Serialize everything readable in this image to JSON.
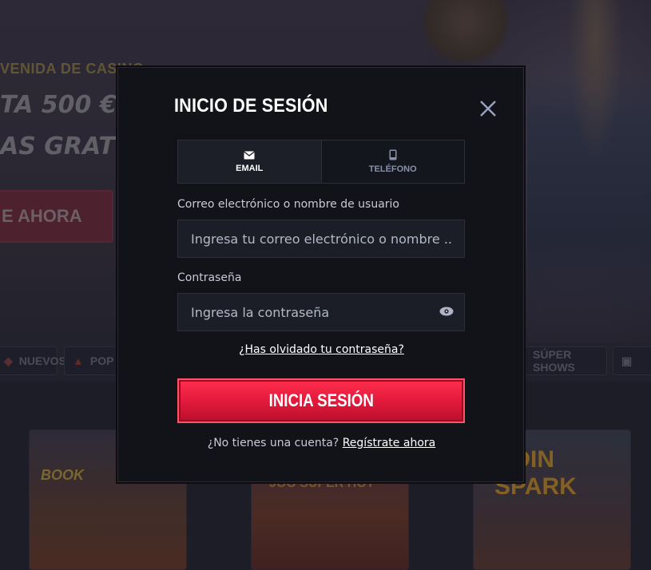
{
  "background": {
    "hero_subtitle": "VENIDA DE CASINO",
    "hero_line1": "TA 500 €",
    "hero_line2": "AS GRAT",
    "hero_cta": "E AHORA",
    "categories": [
      {
        "label": "NUEVOS",
        "icon": "new-icon"
      },
      {
        "label": "POP",
        "icon": "fire-icon"
      },
      {
        "label": "SÚPER SHOWS",
        "icon": ""
      },
      {
        "label": "",
        "icon": "cards-icon"
      }
    ],
    "tiles": [
      {
        "text": "BOOK"
      },
      {
        "text": "JOO SUPER HOT"
      },
      {
        "text": "COIN SPARK"
      }
    ]
  },
  "modal": {
    "title": "INICIO DE SESIÓN",
    "close_icon": "close-icon",
    "tabs": [
      {
        "label": "EMAIL",
        "icon": "envelope-icon",
        "active": true
      },
      {
        "label": "TELÉFONO",
        "icon": "phone-icon",
        "active": false
      }
    ],
    "email": {
      "label": "Correo electrónico o nombre de usuario",
      "placeholder": "Ingresa tu correo electrónico o nombre ..."
    },
    "password": {
      "label": "Contraseña",
      "placeholder": "Ingresa la contraseña",
      "toggle_icon": "eye-icon"
    },
    "forgot_password": "¿Has olvidado tu contraseña?",
    "submit_label": "INICIA SESIÓN",
    "no_account_text": "¿No tienes una cuenta?",
    "signup_link": "Regístrate ahora"
  },
  "colors": {
    "accent": "#e8193c",
    "modal_bg": "#121219",
    "input_bg": "#1c1e27"
  }
}
